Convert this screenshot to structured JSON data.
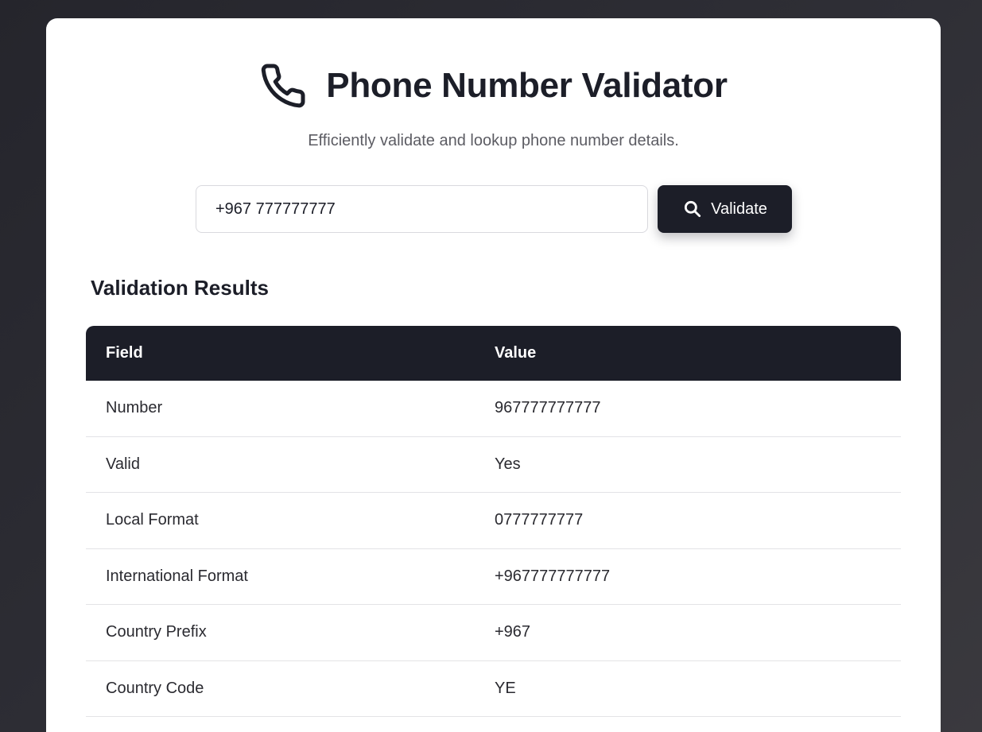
{
  "colors": {
    "background": "#2b2b31",
    "card": "#ffffff",
    "accent_dark": "#1c1e28",
    "subtitle": "#5c5c63",
    "row_border": "#e3e3e6"
  },
  "header": {
    "icon": "phone-icon",
    "title": "Phone Number Validator",
    "subtitle": "Efficiently validate and lookup phone number details."
  },
  "search": {
    "value": "+967 777777777",
    "placeholder": "",
    "button_icon": "search-icon",
    "button_label": "Validate"
  },
  "results": {
    "title": "Validation Results",
    "columns": [
      "Field",
      "Value"
    ],
    "rows": [
      {
        "field": "Number",
        "value": "967777777777"
      },
      {
        "field": "Valid",
        "value": "Yes"
      },
      {
        "field": "Local Format",
        "value": "0777777777"
      },
      {
        "field": "International Format",
        "value": "+967777777777"
      },
      {
        "field": "Country Prefix",
        "value": "+967"
      },
      {
        "field": "Country Code",
        "value": "YE"
      }
    ]
  }
}
